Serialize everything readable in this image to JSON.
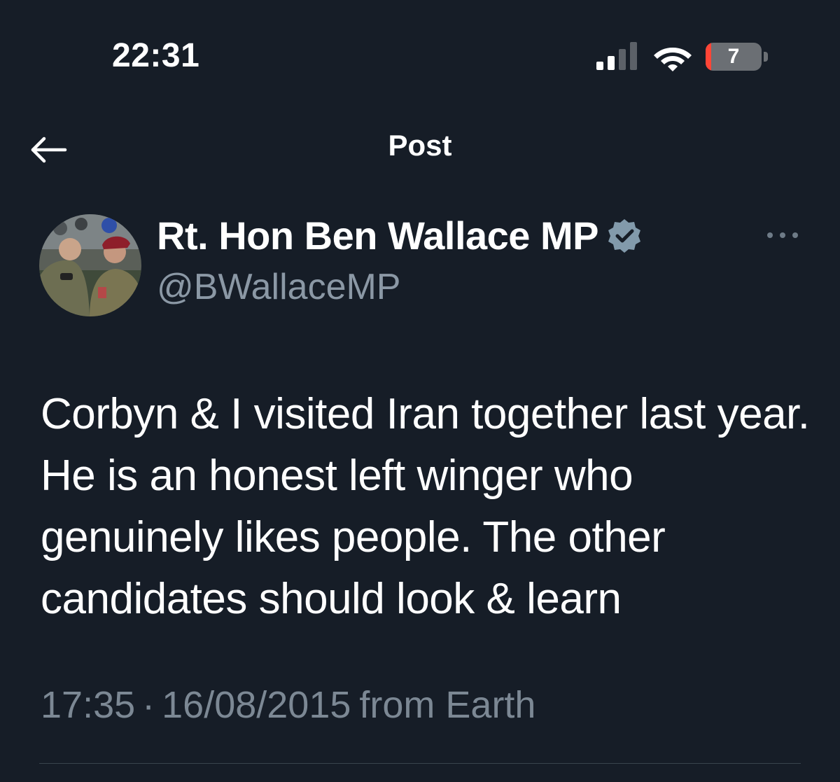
{
  "status_bar": {
    "time": "22:31",
    "battery_level": "7",
    "battery_fraction": 0.07,
    "signal_icon": "cellular-signal-icon",
    "wifi_icon": "wifi-icon",
    "battery_icon": "battery-icon"
  },
  "header": {
    "title": "Post",
    "back_icon": "arrow-left-icon"
  },
  "author": {
    "display_name": "Rt. Hon Ben Wallace MP",
    "handle": "@BWallaceMP",
    "verified_icon": "verified-badge-icon",
    "more_icon": "more-horizontal-icon"
  },
  "post": {
    "text": "Corbyn & I visited Iran together last year. He is an honest left winger who genuinely likes people. The other candidates should look & learn",
    "time": "17:35",
    "separator": "·",
    "date": "16/08/2015",
    "source": "from Earth"
  },
  "colors": {
    "background": "#161d27",
    "text_primary": "#ffffff",
    "text_secondary": "#8b98a5",
    "verified_badge": "#829aab",
    "battery_low": "#ff4536",
    "divider": "#38444d"
  }
}
